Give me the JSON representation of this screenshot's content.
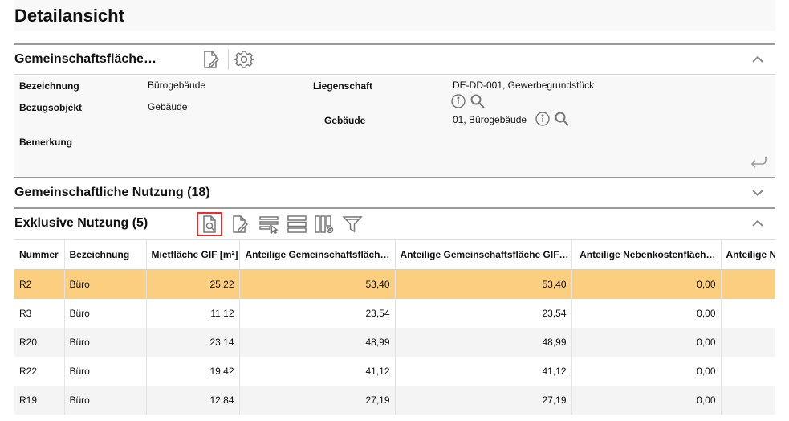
{
  "page": {
    "title": "Detailansicht"
  },
  "section_detail": {
    "title": "Gemeinschaftsfläche…",
    "fields": {
      "bezeichnung_label": "Bezeichnung",
      "bezeichnung_value": "Bürogebäude",
      "bezugsobjekt_label": "Bezugsobjekt",
      "bezugsobjekt_value": "Gebäude",
      "bemerkung_label": "Bemerkung",
      "liegenschaft_label": "Liegenschaft",
      "liegenschaft_value": "DE-DD-001, Gewerbegrundstück",
      "gebaeude_label": "Gebäude",
      "gebaeude_value": "01, Bürogebäude"
    }
  },
  "section_shared": {
    "title": "Gemeinschaftliche Nutzung (18)"
  },
  "section_exclusive": {
    "title": "Exklusive Nutzung (5)",
    "columns": [
      "Nummer",
      "Bezeichnung",
      "Mietfläche GIF [m²]",
      "Anteilige Gemeinschaftsfläch…",
      "Anteilige Gemeinschaftsfläche GIF…",
      "Anteilige Nebenkostenfläch…",
      "Anteilige Ne"
    ],
    "rows": [
      {
        "nummer": "R2",
        "bezeichnung": "Büro",
        "mietflaeche": "25,22",
        "anteil_gem": "53,40",
        "anteil_gem_gif": "53,40",
        "anteil_nk": "0,00",
        "anteil_ne": ""
      },
      {
        "nummer": "R3",
        "bezeichnung": "Büro",
        "mietflaeche": "11,12",
        "anteil_gem": "23,54",
        "anteil_gem_gif": "23,54",
        "anteil_nk": "0,00",
        "anteil_ne": ""
      },
      {
        "nummer": "R20",
        "bezeichnung": "Büro",
        "mietflaeche": "23,14",
        "anteil_gem": "48,99",
        "anteil_gem_gif": "48,99",
        "anteil_nk": "0,00",
        "anteil_ne": ""
      },
      {
        "nummer": "R22",
        "bezeichnung": "Büro",
        "mietflaeche": "19,42",
        "anteil_gem": "41,12",
        "anteil_gem_gif": "41,12",
        "anteil_nk": "0,00",
        "anteil_ne": ""
      },
      {
        "nummer": "R19",
        "bezeichnung": "Büro",
        "mietflaeche": "12,84",
        "anteil_gem": "27,19",
        "anteil_gem_gif": "27,19",
        "anteil_nk": "0,00",
        "anteil_ne": ""
      }
    ],
    "selected_row": 0
  },
  "colors": {
    "selected_row": "#fccf80",
    "highlight_border": "#e03030",
    "icon": "#777777"
  },
  "icons": [
    "edit-document-icon",
    "gear-icon",
    "chevron-up-icon",
    "chevron-down-icon",
    "info-icon",
    "search-icon",
    "return-arrow-icon",
    "document-search-icon",
    "column-filter-icon",
    "rows-icon",
    "column-settings-icon",
    "funnel-icon"
  ]
}
